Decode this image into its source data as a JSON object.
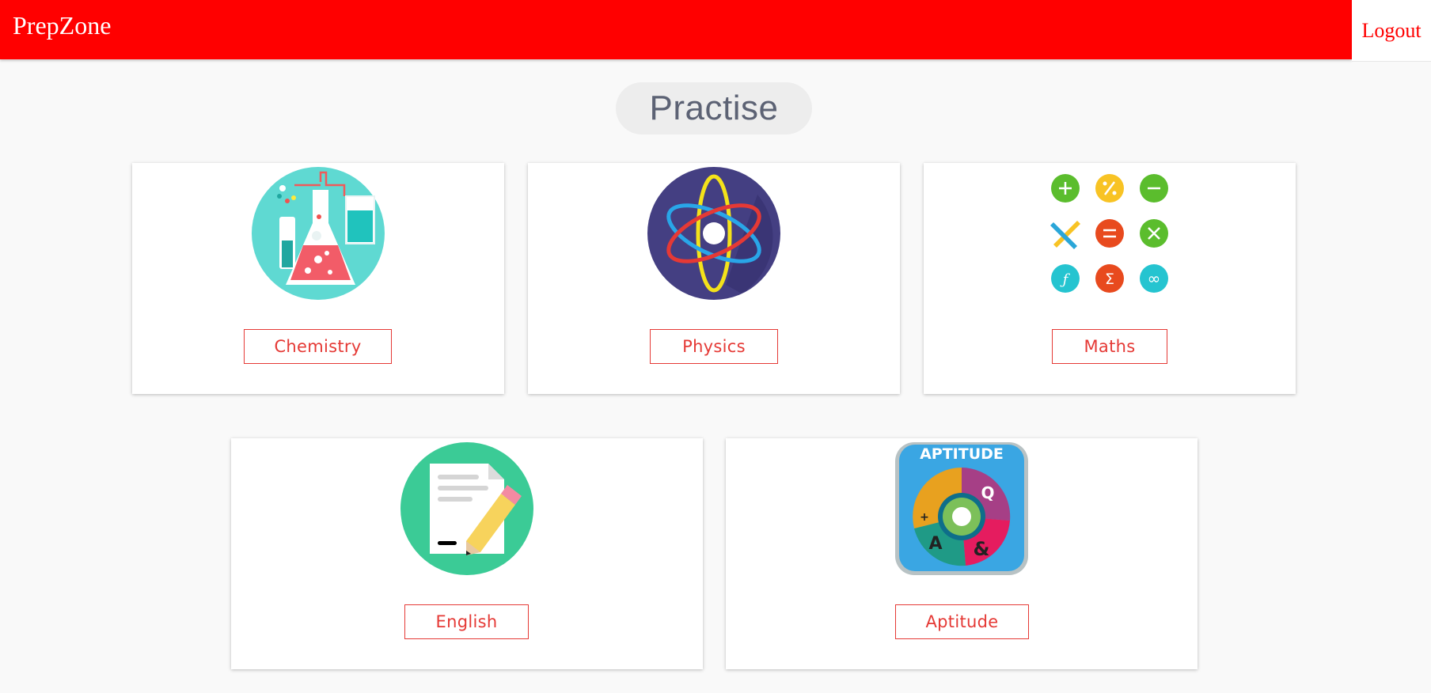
{
  "navbar": {
    "brand": "PrepZone",
    "logout_label": "Logout"
  },
  "page": {
    "title": "Practise"
  },
  "subjects": [
    {
      "label": "Chemistry",
      "icon": "chemistry-flask-icon"
    },
    {
      "label": "Physics",
      "icon": "atom-icon"
    },
    {
      "label": "Maths",
      "icon": "math-symbols-icon"
    },
    {
      "label": "English",
      "icon": "document-pencil-icon"
    },
    {
      "label": "Aptitude",
      "icon": "aptitude-wheel-icon",
      "art_text": "APTITUDE"
    }
  ],
  "colors": {
    "primary": "#ff0000",
    "button": "#e53935",
    "title": "#5c6274"
  }
}
